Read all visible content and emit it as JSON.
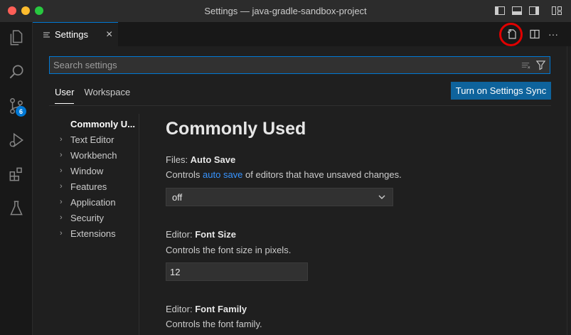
{
  "window": {
    "title": "Settings — java-gradle-sandbox-project"
  },
  "activity_bar": {
    "source_control_badge": "6"
  },
  "tab": {
    "label": "Settings",
    "close": "×"
  },
  "editor_actions": {
    "more": "···"
  },
  "search": {
    "placeholder": "Search settings",
    "value": ""
  },
  "scope_tabs": {
    "user": "User",
    "workspace": "Workspace"
  },
  "sync_button": "Turn on Settings Sync",
  "toc": {
    "active": "Commonly U...",
    "items": [
      {
        "label": "Text Editor"
      },
      {
        "label": "Workbench"
      },
      {
        "label": "Window"
      },
      {
        "label": "Features"
      },
      {
        "label": "Application"
      },
      {
        "label": "Security"
      },
      {
        "label": "Extensions"
      }
    ]
  },
  "main": {
    "heading": "Commonly Used",
    "settings": [
      {
        "category": "Files: ",
        "name": "Auto Save",
        "desc_before": "Controls ",
        "desc_link": "auto save",
        "desc_after": " of editors that have unsaved changes.",
        "value": "off"
      },
      {
        "category": "Editor: ",
        "name": "Font Size",
        "desc": "Controls the font size in pixels.",
        "value": "12"
      },
      {
        "category": "Editor: ",
        "name": "Font Family",
        "desc": "Controls the font family."
      }
    ]
  },
  "colors": {
    "accent": "#0078d4",
    "button": "#0e639c",
    "link": "#3794ff",
    "highlight_ring": "#e00000"
  }
}
